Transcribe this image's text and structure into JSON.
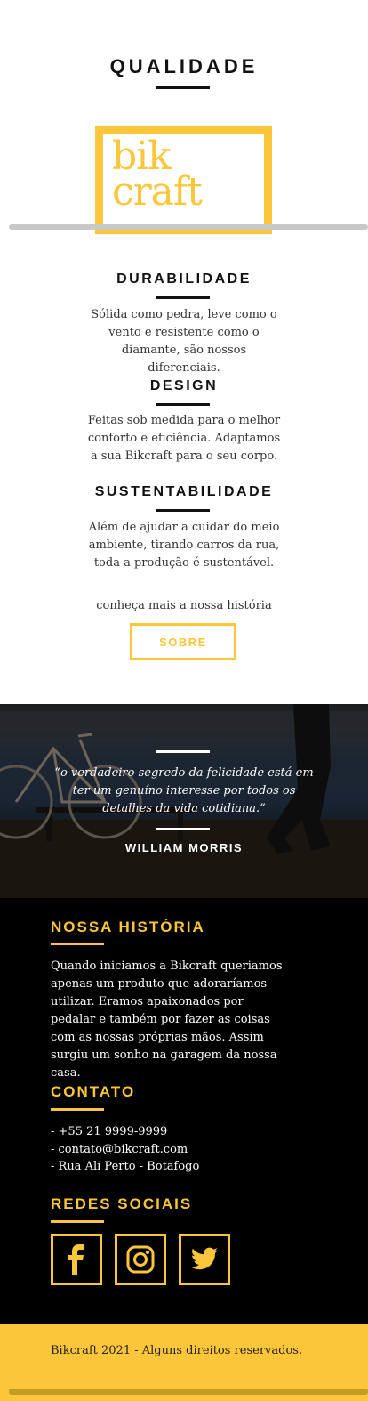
{
  "quality": {
    "title": "QUALIDADE",
    "logo_line1": "bik",
    "logo_line2": "craft",
    "features": [
      {
        "title": "DURABILIDADE",
        "text": "Sólida como pedra, leve como o vento e resistente como o diamante, são nossos diferenciais."
      },
      {
        "title": "DESIGN",
        "text": "Feitas sob medida para o melhor conforto e eficiência. Adaptamos a sua Bikcraft para o seu corpo."
      },
      {
        "title": "SUSTENTABILIDADE",
        "text": "Além de ajudar a cuidar do meio ambiente, tirando carros da rua, toda a produção é sustentável."
      }
    ],
    "more_text": "conheça mais a nossa história",
    "button_label": "SOBRE"
  },
  "quote": {
    "text": "“o verdadeiro segredo da felicidade está em ter um genuíno interesse por todos os detalhes da vida cotidiana.”",
    "author": "WILLIAM MORRIS"
  },
  "footer": {
    "history_title": "NOSSA HISTÓRIA",
    "history_text": "Quando iniciamos a Bikcraft queriamos apenas um produto que adoraríamos utilizar. Eramos apaixonados por pedalar e também por fazer as coisas com as nossas próprias mãos. Assim surgiu um sonho na garagem da nossa casa.",
    "contact_title": "CONTATO",
    "contact_items": [
      "- +55 21 9999-9999",
      "- contato@bikcraft.com",
      "- Rua Ali Perto - Botafogo"
    ],
    "social_title": "REDES SOCIAIS",
    "social_icons": [
      "facebook-icon",
      "instagram-icon",
      "twitter-icon"
    ],
    "copyright": "Bikcraft 2021 - Alguns direitos reservados."
  },
  "colors": {
    "accent": "#FBC639",
    "dark": "#000000"
  }
}
